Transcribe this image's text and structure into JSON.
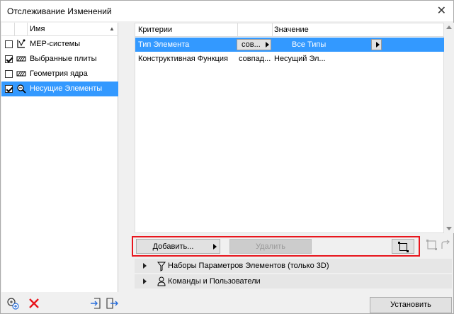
{
  "window": {
    "title": "Отслеживание Изменений"
  },
  "left_list": {
    "column_header": "Имя",
    "items": [
      {
        "label": "MEP-системы",
        "checked": false,
        "icon": "mep-icon",
        "selected": false
      },
      {
        "label": "Выбранные плиты",
        "checked": true,
        "icon": "hatch-icon",
        "selected": false
      },
      {
        "label": "Геометрия ядра",
        "checked": false,
        "icon": "hatch-icon",
        "selected": false
      },
      {
        "label": "Несущие Элементы",
        "checked": true,
        "icon": "structural-icon",
        "selected": true
      }
    ]
  },
  "criteria_table": {
    "headers": {
      "criteria": "Критерии",
      "value": "Значение"
    },
    "rows": [
      {
        "criterion": "Тип Элемента",
        "operator": "сов...",
        "value": "Все Типы",
        "selected": true
      },
      {
        "criterion": "Конструктивная Функция",
        "operator": "совпад...",
        "value": "Несущий Эл...",
        "selected": false
      }
    ]
  },
  "toolbar": {
    "add_label": "Добавить...",
    "delete_label": "Удалить"
  },
  "sections": {
    "element_parameter_sets": "Наборы Параметров Элементов (только 3D)",
    "commands_users": "Команды и Пользователи"
  },
  "buttons": {
    "install": "Установить"
  },
  "colors": {
    "selection": "#3399ff",
    "highlight_border": "#e8161d"
  }
}
